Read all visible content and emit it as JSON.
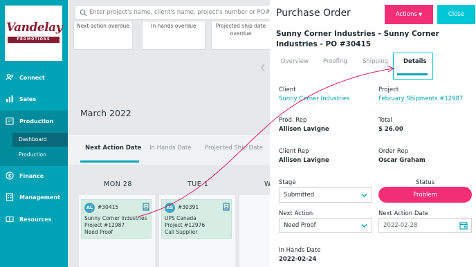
{
  "search": {
    "placeholder": "Enter project's name, client's name, project's number or PO#"
  },
  "sidebar": {
    "logo_text": "Vandelay",
    "logo_sub": "PROMOTIONS",
    "items": [
      {
        "label": "Connect",
        "icon": "people-icon"
      },
      {
        "label": "Sales",
        "icon": "bar-chart-icon"
      },
      {
        "label": "Production",
        "icon": "production-icon"
      },
      {
        "label": "Finance",
        "icon": "dollar-icon"
      },
      {
        "label": "Management",
        "icon": "building-icon"
      },
      {
        "label": "Resources",
        "icon": "book-icon"
      }
    ],
    "sub_items": [
      {
        "label": "Dashboard"
      },
      {
        "label": "Production"
      }
    ]
  },
  "board": {
    "top_cards": [
      "Next action overdue",
      "In hands overdue",
      "Projected ship date overdue"
    ],
    "month": "March 2022",
    "tabs": [
      "Next Action Date",
      "In Hands Date",
      "Projected Ship Date"
    ],
    "days": [
      "MON  28",
      "TUE  1",
      "W"
    ],
    "cards": [
      {
        "initials": "AL",
        "po": "#30415",
        "line1": "Sunny Corner Industries",
        "line2": "Project #12987",
        "line3": "Need Proof"
      },
      {
        "initials": "AS",
        "po": "#30391",
        "line1": "UPS Canada",
        "line2": "Project #12976",
        "line3": "Call Supplier"
      }
    ]
  },
  "panel": {
    "title": "Purchase Order",
    "actions_label": "Actions",
    "close_label": "Close",
    "subtitle": "Sunny Corner Industries - Sunny Corner Industries - PO #30415",
    "tabs": [
      "Overview",
      "Proofing",
      "Shipping",
      "Details"
    ],
    "client_label": "Client",
    "client_value": "Sunny Corner Industries",
    "project_label": "Project",
    "project_value": "February Shipments #12987",
    "prod_rep_label": "Prod. Rep",
    "prod_rep_value": "Allison Lavigne",
    "total_label": "Total",
    "total_value": "$ 26.00",
    "client_rep_label": "Client Rep",
    "client_rep_value": "Allison Lavigne",
    "order_rep_label": "Order Rep",
    "order_rep_value": "Oscar Graham",
    "stage_label": "Stage",
    "stage_value": "Submitted",
    "status_label": "Status",
    "status_value": "Problem",
    "next_action_label": "Next Action",
    "next_action_value": "Need Proof",
    "next_action_date_label": "Next Action Date",
    "next_action_date_value": "2022-02-28",
    "in_hands_label": "In Hands Date",
    "in_hands_value": "2022-02-24"
  },
  "colors": {
    "teal": "#00a3b5",
    "pink": "#f22e76",
    "cyan": "#00c7d6",
    "card_green": "#d6ede3"
  }
}
